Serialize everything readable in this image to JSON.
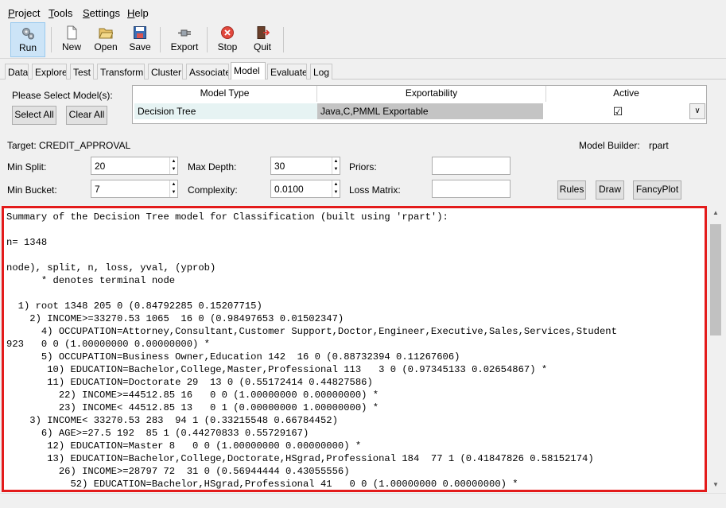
{
  "menu": {
    "project": {
      "ul": "P",
      "rest": "roject"
    },
    "tools": {
      "ul": "T",
      "rest": "ools"
    },
    "settings": {
      "ul": "S",
      "rest": "ettings"
    },
    "help": {
      "ul": "H",
      "rest": "elp"
    }
  },
  "toolbar": {
    "run": "Run",
    "new": "New",
    "open": "Open",
    "save": "Save",
    "export": "Export",
    "stop": "Stop",
    "quit": "Quit"
  },
  "tabs": [
    "Data",
    "Explore",
    "Test",
    "Transform",
    "Cluster",
    "Associate",
    "Model",
    "Evaluate",
    "Log"
  ],
  "active_tab": "Model",
  "model_panel": {
    "select_prompt": "Please Select Model(s):",
    "select_all": "Select All",
    "clear_all": "Clear All",
    "table_headers": [
      "Model Type",
      "Exportability",
      "Active"
    ],
    "row": {
      "model_type": "Decision Tree",
      "exportability": "Java,C,PMML Exportable",
      "active": "☑"
    },
    "target": "Target: CREDIT_APPROVAL",
    "model_builder_label": "Model Builder:",
    "model_builder_value": "rpart",
    "min_split_label": "Min Split:",
    "min_split": "20",
    "max_depth_label": "Max Depth:",
    "max_depth": "30",
    "priors_label": "Priors:",
    "min_bucket_label": "Min Bucket:",
    "min_bucket": "7",
    "complexity_label": "Complexity:",
    "complexity": "0.0100",
    "loss_matrix_label": "Loss Matrix:",
    "rules": "Rules",
    "draw": "Draw",
    "fancyplot": "FancyPlot"
  },
  "output_text": "Summary of the Decision Tree model for Classification (built using 'rpart'):\n\nn= 1348\n\nnode), split, n, loss, yval, (yprob)\n      * denotes terminal node\n\n  1) root 1348 205 0 (0.84792285 0.15207715)\n    2) INCOME>=33270.53 1065  16 0 (0.98497653 0.01502347)\n      4) OCCUPATION=Attorney,Consultant,Customer Support,Doctor,Engineer,Executive,Sales,Services,Student\n923   0 0 (1.00000000 0.00000000) *\n      5) OCCUPATION=Business Owner,Education 142  16 0 (0.88732394 0.11267606)\n       10) EDUCATION=Bachelor,College,Master,Professional 113   3 0 (0.97345133 0.02654867) *\n       11) EDUCATION=Doctorate 29  13 0 (0.55172414 0.44827586)\n         22) INCOME>=44512.85 16   0 0 (1.00000000 0.00000000) *\n         23) INCOME< 44512.85 13   0 1 (0.00000000 1.00000000) *\n    3) INCOME< 33270.53 283  94 1 (0.33215548 0.66784452)\n      6) AGE>=27.5 192  85 1 (0.44270833 0.55729167)\n       12) EDUCATION=Master 8   0 0 (1.00000000 0.00000000) *\n       13) EDUCATION=Bachelor,College,Doctorate,HSgrad,Professional 184  77 1 (0.41847826 0.58152174)\n         26) INCOME>=28797 72  31 0 (0.56944444 0.43055556)\n           52) EDUCATION=Bachelor,HSgrad,Professional 41   0 0 (1.00000000 0.00000000) *"
}
